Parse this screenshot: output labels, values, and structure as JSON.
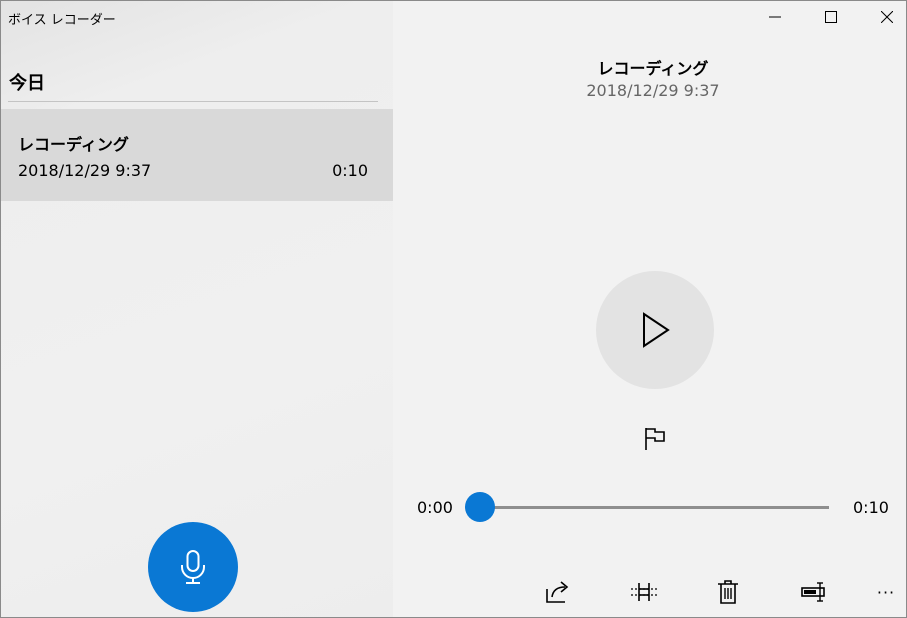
{
  "window": {
    "title": "ボイス レコーダー"
  },
  "list": {
    "section_header": "今日",
    "items": [
      {
        "name": "レコーディング",
        "date": "2018/12/29 9:37",
        "duration": "0:10"
      }
    ]
  },
  "detail": {
    "title": "レコーディング",
    "date": "2018/12/29 9:37",
    "time_start": "0:00",
    "time_end": "0:10",
    "progress": 0
  },
  "toolbar": {
    "more_label": "···"
  },
  "icons": {
    "minimize": "minimize-icon",
    "maximize": "maximize-icon",
    "close": "close-icon",
    "record": "microphone-icon",
    "play": "play-icon",
    "marker": "flag-icon",
    "share": "share-icon",
    "trim": "trim-icon",
    "delete": "trash-icon",
    "rename": "rename-icon",
    "more": "more-icon"
  },
  "colors": {
    "accent": "#0a78d4",
    "selected_item": "#d9d9d9",
    "play_button": "#e3e3e3",
    "secondary_text": "#666666"
  }
}
